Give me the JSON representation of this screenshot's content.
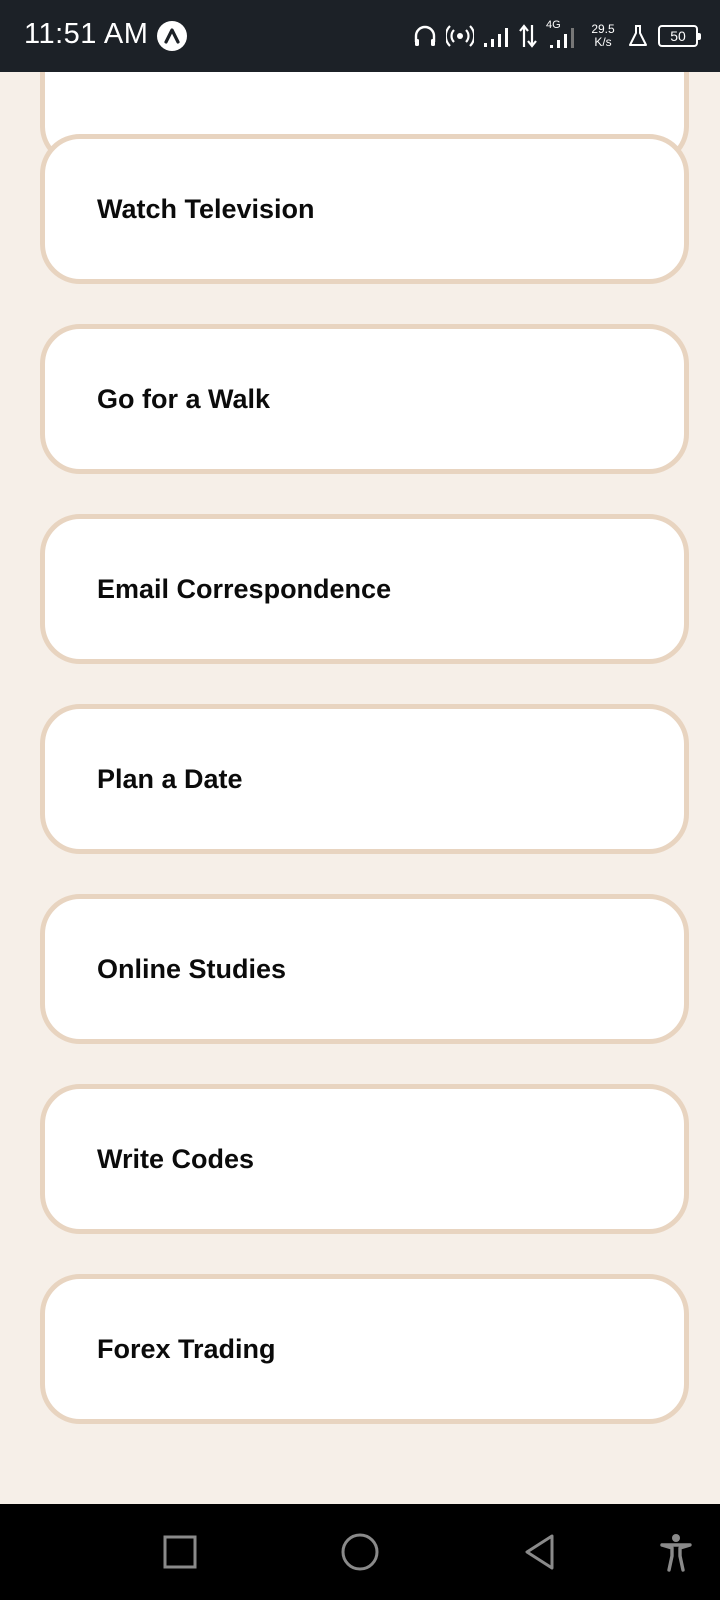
{
  "status_bar": {
    "time": "11:51 AM",
    "network_type": "4G",
    "net_speed_value": "29.5",
    "net_speed_unit": "K/s",
    "battery_level": "50"
  },
  "activities": [
    {
      "label": "Watch Television"
    },
    {
      "label": "Go for a Walk"
    },
    {
      "label": "Email Correspondence"
    },
    {
      "label": "Plan a Date"
    },
    {
      "label": "Online Studies"
    },
    {
      "label": "Write Codes"
    },
    {
      "label": "Forex Trading"
    }
  ],
  "icons": {
    "app_badge": "app-logo-icon",
    "headphones": "headphones-icon",
    "hotspot": "hotspot-icon",
    "signal": "signal-icon",
    "data_arrows": "data-arrows-icon",
    "signal_4g": "signal-4g-icon",
    "flask": "flask-icon",
    "recents": "square-recents-icon",
    "home": "circle-home-icon",
    "back": "triangle-back-icon",
    "accessibility": "accessibility-icon"
  },
  "colors": {
    "background": "#f6efe8",
    "card_border": "#e8d4c0",
    "status_bar": "#1c2127",
    "nav_bar": "#000000"
  }
}
